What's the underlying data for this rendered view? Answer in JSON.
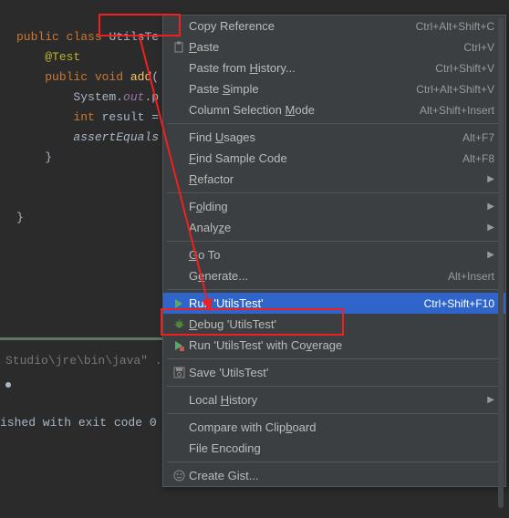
{
  "code": {
    "l1a": "public class",
    "l1b": "UtilsTe",
    "l1c": "{",
    "l2a": "@Test",
    "l3a": "public void",
    "l3b": "add",
    "l3c": "(",
    "l4a": "System.",
    "l4b": "out",
    "l4c": ".p",
    "l5a": "int",
    "l5b": " result = ",
    "l6a": "assertEquals",
    "l7a": "}",
    "l8a": "}"
  },
  "output": {
    "path": "Studio\\jre\\bin\\java\" .",
    "exit": "ished with exit code 0"
  },
  "menu": {
    "copy_reference": "Copy Reference",
    "copy_reference_sc": "Ctrl+Alt+Shift+C",
    "paste": "Paste",
    "paste_sc": "Ctrl+V",
    "paste_history": "Paste from History...",
    "paste_history_sc": "Ctrl+Shift+V",
    "paste_simple": "Paste Simple",
    "paste_simple_sc": "Ctrl+Alt+Shift+V",
    "col_select": "Column Selection Mode",
    "col_select_sc": "Alt+Shift+Insert",
    "find_usages": "Find Usages",
    "find_usages_sc": "Alt+F7",
    "find_sample": "Find Sample Code",
    "find_sample_sc": "Alt+F8",
    "refactor": "Refactor",
    "folding": "Folding",
    "analyze": "Analyze",
    "goto": "Go To",
    "generate": "Generate...",
    "generate_sc": "Alt+Insert",
    "run": "Run 'UtilsTest'",
    "run_sc": "Ctrl+Shift+F10",
    "debug": "Debug 'UtilsTest'",
    "coverage": "Run 'UtilsTest' with Coverage",
    "save": "Save 'UtilsTest'",
    "local_history": "Local History",
    "compare_clip": "Compare with Clipboard",
    "file_encoding": "File Encoding",
    "create_gist": "Create Gist..."
  }
}
